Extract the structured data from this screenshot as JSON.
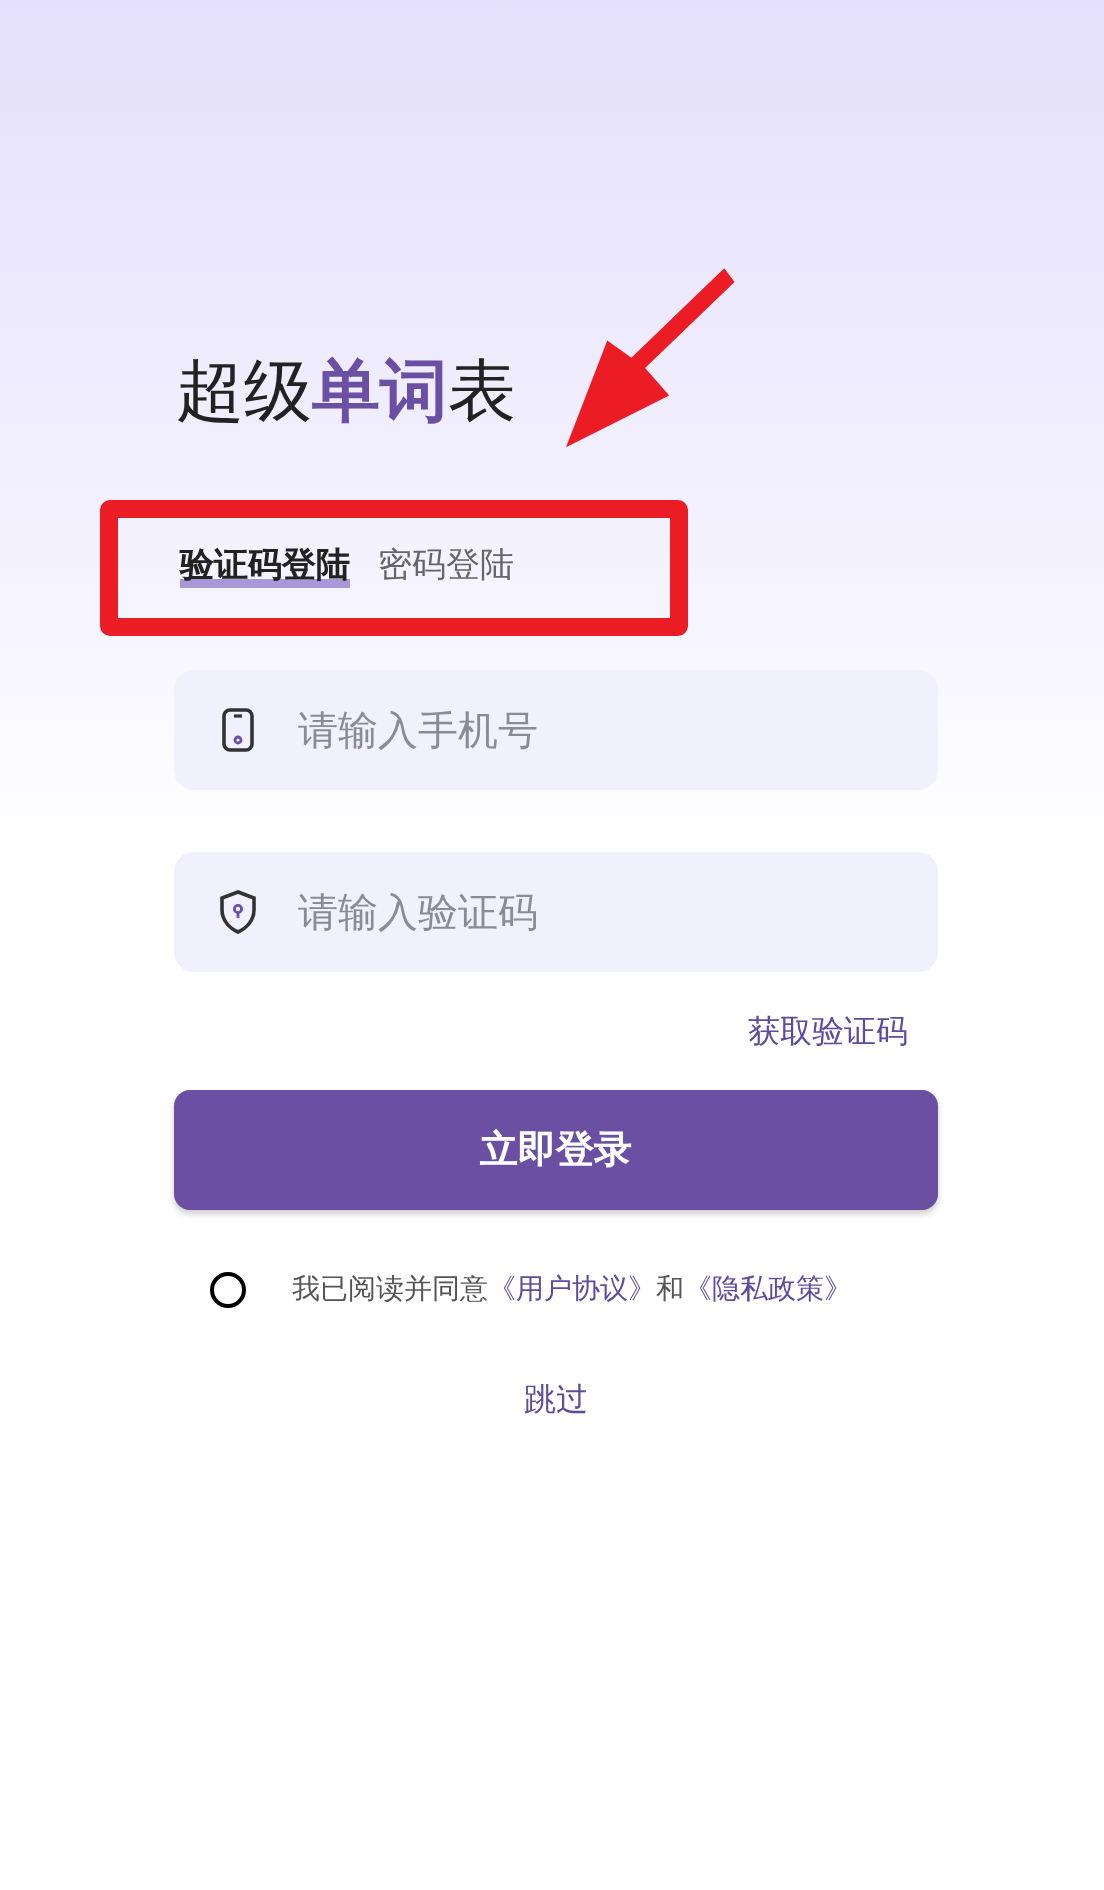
{
  "title": "超级**单词**表",
  "tabs": [
    {
      "label": "验证码登陆",
      "selected": true
    },
    {
      "label": "密码登陆",
      "selected": false
    }
  ],
  "fields": [
    {
      "kind": "phone",
      "placeholder": "请输入手机号"
    },
    {
      "kind": "code",
      "placeholder": "请输入验证码"
    }
  ],
  "get_code_link": "获取验证码",
  "login_button": "立即登录",
  "agreement": {
    "checked": false,
    "text_before": "我已阅读并同意",
    "link_1": "《用户协议》",
    "text_between": "和",
    "link_2": "《隐私政策》"
  },
  "skip_link": "跳过"
}
